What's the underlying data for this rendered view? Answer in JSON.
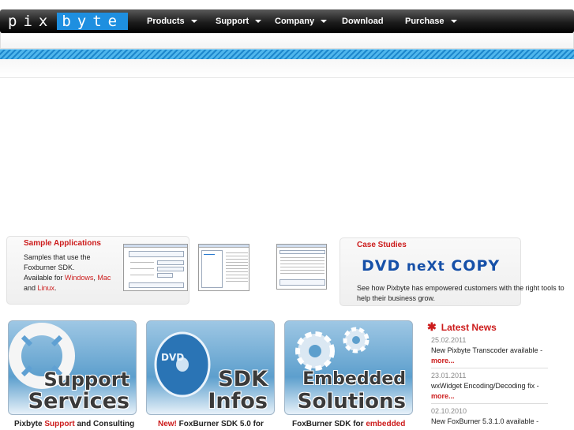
{
  "logo": {
    "part1": "pix",
    "part2": "byte"
  },
  "nav": [
    {
      "label": "Products",
      "dropdown": true
    },
    {
      "label": "Support",
      "dropdown": true
    },
    {
      "label": "Company",
      "dropdown": true
    },
    {
      "label": "Download",
      "dropdown": false
    },
    {
      "label": "Purchase",
      "dropdown": true
    }
  ],
  "sample": {
    "title": "Sample Applications",
    "line1": "Samples that use the",
    "line2": "Foxburner SDK.",
    "line3_prefix": "Available for ",
    "link_windows": "Windows",
    "comma": ", ",
    "link_mac": "Mac",
    "and": "and ",
    "link_linux": "Linux",
    "period": "."
  },
  "case": {
    "title": "Case Studies",
    "logo_dvd": "DVD ",
    "logo_next": "neXt",
    "logo_copy": " COPY",
    "text": "See how Pixbyte has empowered customers with the right tools to help their business grow."
  },
  "tiles": [
    {
      "line1": "Support",
      "line2": "Services",
      "caption_a": "Pixbyte ",
      "caption_red": "Support",
      "caption_b": " and Consulting"
    },
    {
      "line1": "SDK",
      "line2": "Infos",
      "caption_red": "New!",
      "caption_b": " FoxBurner SDK 5.0 for"
    },
    {
      "line1": "Embedded",
      "line2": "Solutions",
      "caption_a": "FoxBurner SDK for ",
      "caption_red": "embedded"
    }
  ],
  "news": {
    "title": "Latest News",
    "items": [
      {
        "date": "25.02.2011",
        "text": "New Pixbyte Transcoder available -",
        "more": "more..."
      },
      {
        "date": "23.01.2011",
        "text": "wxWidget Encoding/Decoding fix -",
        "more": "more..."
      },
      {
        "date": "02.10.2010",
        "text": "New FoxBurner 5.3.1.0 available -",
        "more": ""
      }
    ]
  },
  "colors": {
    "accent_red": "#cc1b1b",
    "brand_blue": "#1e8fe0"
  }
}
